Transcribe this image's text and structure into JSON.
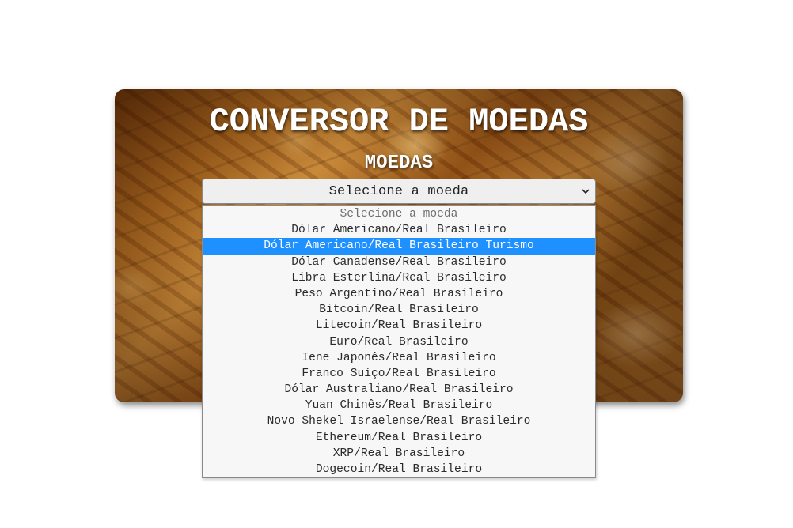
{
  "header": {
    "title": "CONVERSOR DE MOEDAS",
    "subtitle": "MOEDAS"
  },
  "currency_select": {
    "selected_display": "Selecione a moeda",
    "highlighted_index": 2,
    "options": [
      "Selecione a moeda",
      "Dólar Americano/Real Brasileiro",
      "Dólar Americano/Real Brasileiro Turismo",
      "Dólar Canadense/Real Brasileiro",
      "Libra Esterlina/Real Brasileiro",
      "Peso Argentino/Real Brasileiro",
      "Bitcoin/Real Brasileiro",
      "Litecoin/Real Brasileiro",
      "Euro/Real Brasileiro",
      "Iene Japonês/Real Brasileiro",
      "Franco Suíço/Real Brasileiro",
      "Dólar Australiano/Real Brasileiro",
      "Yuan Chinês/Real Brasileiro",
      "Novo Shekel Israelense/Real Brasileiro",
      "Ethereum/Real Brasileiro",
      "XRP/Real Brasileiro",
      "Dogecoin/Real Brasileiro"
    ]
  },
  "colors": {
    "highlight": "#1e90ff",
    "title_text": "#ffffff",
    "card_tone": "#a8651d"
  },
  "icons": {
    "select_arrow": "chevron-down-icon"
  }
}
